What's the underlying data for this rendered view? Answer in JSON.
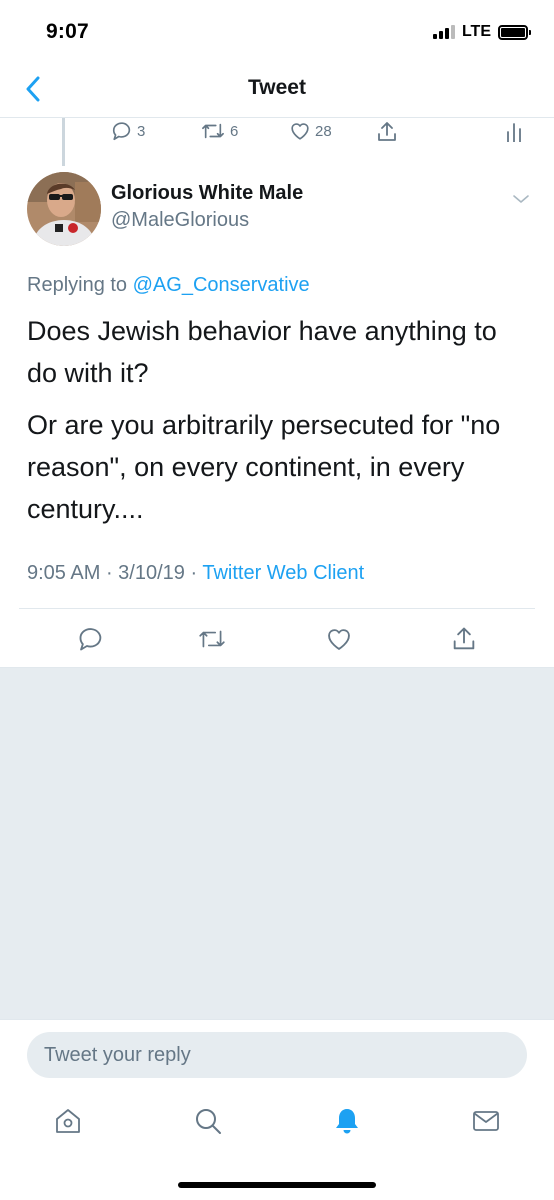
{
  "status_bar": {
    "time": "9:07",
    "network": "LTE"
  },
  "nav": {
    "title": "Tweet"
  },
  "previous_tweet": {
    "reply_count": "3",
    "retweet_count": "6",
    "like_count": "28"
  },
  "tweet": {
    "display_name": "Glorious White Male",
    "handle": "@MaleGlorious",
    "replying_prefix": "Replying to",
    "replying_to": "@AG_Conservative",
    "paragraphs": [
      "Does Jewish behavior have anything to do with it?",
      "Or are you arbitrarily persecuted for \"no reason\", on every continent, in every century...."
    ],
    "time": "9:05 AM",
    "separator1": " · ",
    "date": "3/10/19",
    "separator2": " · ",
    "client": "Twitter Web Client"
  },
  "reply": {
    "placeholder": "Tweet your reply"
  },
  "colors": {
    "accent": "#1da1f2",
    "secondary_text": "#657786",
    "background_gray": "#e6ecf0"
  },
  "icons": {
    "back": "chevron-left-icon",
    "reply": "reply-icon",
    "retweet": "retweet-icon",
    "like": "heart-icon",
    "share": "share-icon",
    "analytics": "analytics-icon",
    "home": "home-icon",
    "search": "search-icon",
    "notifications": "bell-icon",
    "messages": "envelope-icon"
  }
}
